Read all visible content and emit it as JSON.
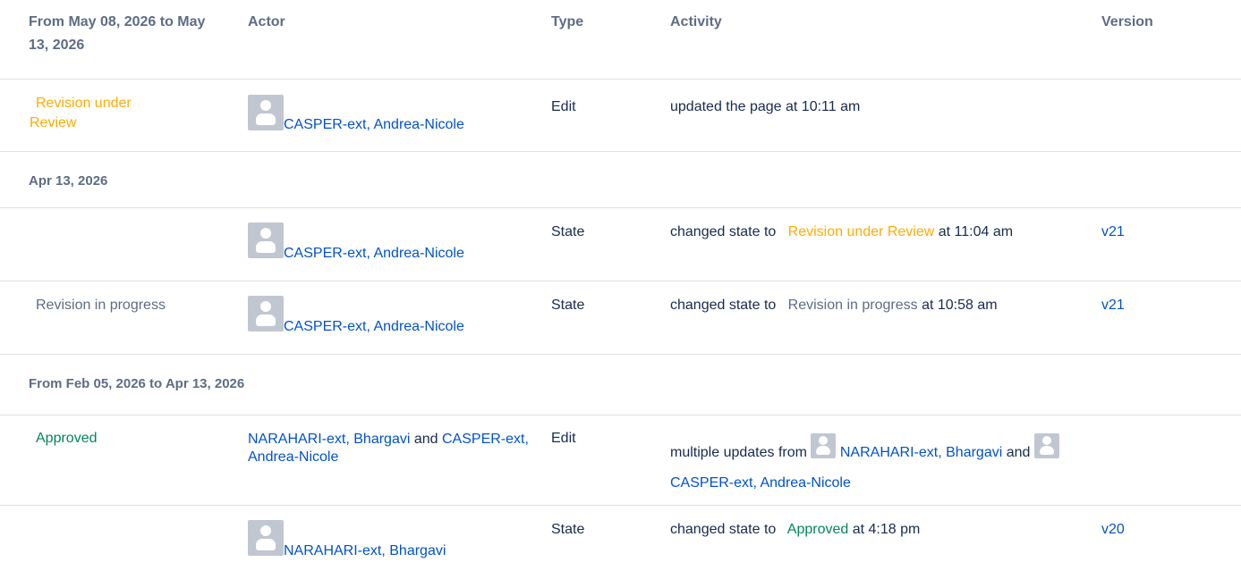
{
  "header": {
    "col1": "From May 08, 2026 to May 13, 2026",
    "col2": "Actor",
    "col3": "Type",
    "col4": "Activity",
    "col5": "Version"
  },
  "rows": [
    {
      "status": "Revision under Review",
      "actor": "CASPER-ext, Andrea-Nicole",
      "type": "Edit",
      "activity": "updated the page at 10:11 am"
    }
  ],
  "group2": "Apr 13, 2026",
  "rows2": [
    {
      "actor": "CASPER-ext, Andrea-Nicole",
      "type": "State",
      "activity_prefix": "changed state to",
      "state": "Revision under Review",
      "time": "at 11:04 am",
      "version": "v21"
    },
    {
      "status": "Revision in progress",
      "actor": "CASPER-ext, Andrea-Nicole",
      "type": "State",
      "activity_prefix": "changed state to",
      "state": "Revision in progress",
      "time": "at 10:58 am",
      "version": "v21"
    }
  ],
  "group3": "From Feb 05, 2026 to Apr 13, 2026",
  "rows3": [
    {
      "status": "Approved",
      "actor1": "NARAHARI-ext, Bhargavi",
      "and": "and",
      "actor2": "CASPER-ext, Andrea-Nicole",
      "type": "Edit",
      "activity_prefix": "multiple updates from",
      "activity_user1": "NARAHARI-ext, Bhargavi",
      "activity_and": "and",
      "activity_user2": "CASPER-ext, Andrea-Nicole"
    },
    {
      "actor": "NARAHARI-ext, Bhargavi",
      "type": "State",
      "activity_prefix": "changed state to",
      "state": "Approved",
      "time": "at 4:18 pm",
      "version": "v20"
    }
  ]
}
